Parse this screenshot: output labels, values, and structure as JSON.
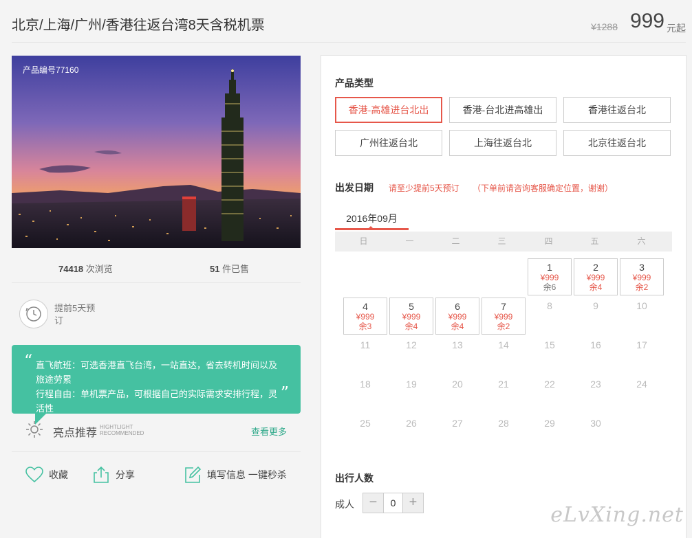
{
  "header": {
    "title": "北京/上海/广州/香港往返台湾8天含税机票",
    "old_price": "¥1288",
    "price": "999",
    "price_suffix": "元起"
  },
  "photo": {
    "product_no": "产品编号77160"
  },
  "stats": {
    "views": "74418",
    "views_label": "次浏览",
    "sold": "51",
    "sold_label": "件已售"
  },
  "advance": {
    "text": "提前5天预订"
  },
  "recommend": {
    "line1": "直飞航班：可选香港直飞台湾，一站直达，省去转机时间以及旅途劳累",
    "line2": "行程自由：单机票产品，可根据自己的实际需求安排行程，灵活性",
    "title": "亮点推荐",
    "sub1": "HIGHTLIGHT",
    "sub2": "RECOMMENDED",
    "more": "查看更多"
  },
  "actions": {
    "favorite": "收藏",
    "share": "分享",
    "fill": "填写信息 一键秒杀"
  },
  "booking": {
    "type_title": "产品类型",
    "types": [
      "香港-高雄进台北出",
      "香港-台北进高雄出",
      "香港往返台北",
      "广州往返台北",
      "上海往返台北",
      "北京往返台北"
    ],
    "date_title": "出发日期",
    "date_note1": "请至少提前5天预订",
    "date_note2": "（下单前请咨询客服确定位置，谢谢）",
    "month": "2016年09月",
    "weekdays": [
      "日",
      "一",
      "二",
      "三",
      "四",
      "五",
      "六"
    ],
    "people_title": "出行人数",
    "adult_label": "成人",
    "adult_count": "0",
    "minus": "−",
    "plus": "+"
  },
  "calendar": {
    "d1": "1",
    "d1_price": "¥999",
    "d1_rem": "余6",
    "d2": "2",
    "d2_price": "¥999",
    "d2_rem": "余4",
    "d3": "3",
    "d3_price": "¥999",
    "d3_rem": "余2",
    "d4": "4",
    "d4_price": "¥999",
    "d4_rem": "余3",
    "d5": "5",
    "d5_price": "¥999",
    "d5_rem": "余4",
    "d6": "6",
    "d6_price": "¥999",
    "d6_rem": "余4",
    "d7": "7",
    "d7_price": "¥999",
    "d7_rem": "余2",
    "d8": "8",
    "d9": "9",
    "d10": "10",
    "d11": "11",
    "d12": "12",
    "d13": "13",
    "d14": "14",
    "d15": "15",
    "d16": "16",
    "d17": "17",
    "d18": "18",
    "d19": "19",
    "d20": "20",
    "d21": "21",
    "d22": "22",
    "d23": "23",
    "d24": "24",
    "d25": "25",
    "d26": "26",
    "d27": "27",
    "d28": "28",
    "d29": "29",
    "d30": "30"
  },
  "watermark": "eLvXing.net",
  "colors": {
    "accent_red": "#e6574a",
    "accent_green": "#45c1a1"
  }
}
